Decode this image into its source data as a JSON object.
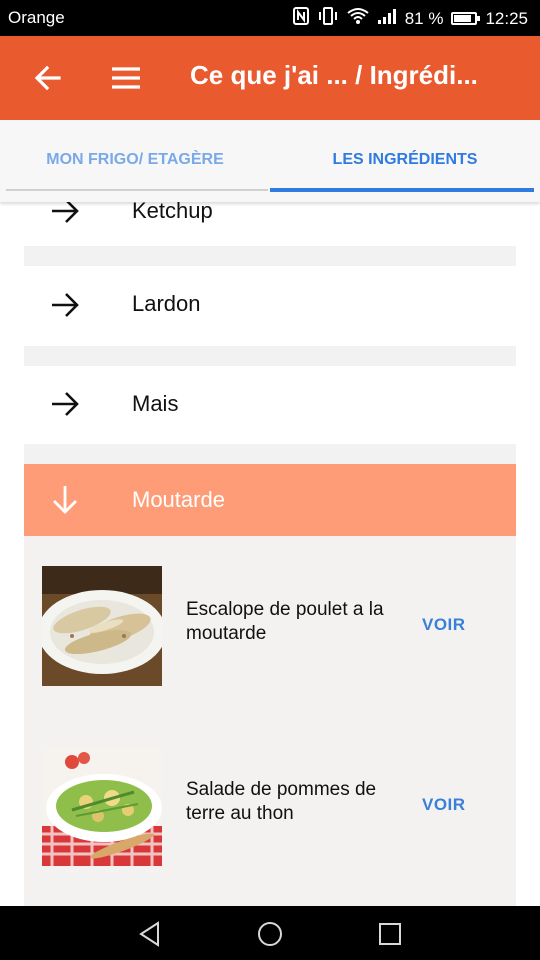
{
  "status_bar": {
    "carrier": "Orange",
    "battery": "81 %",
    "time": "12:25"
  },
  "app_bar": {
    "title": "Ce que j'ai ... / Ingrédi..."
  },
  "tabs": [
    {
      "label": "MON FRIGO/ ETAGÈRE",
      "active": false
    },
    {
      "label": "LES INGRÉDIENTS",
      "active": true
    }
  ],
  "ingredients": [
    {
      "label": "Ketchup"
    },
    {
      "label": "Lardon"
    },
    {
      "label": "Mais"
    }
  ],
  "expanded_ingredient": {
    "label": "Moutarde"
  },
  "recipes": [
    {
      "name": "Escalope de poulet a la moutarde",
      "action": "VOIR"
    },
    {
      "name": "Salade de pommes de terre au thon",
      "action": "VOIR"
    }
  ],
  "colors": {
    "app_bar": "#e95a2f",
    "expanded_row": "#ff9c78",
    "accent": "#2f7be0"
  }
}
